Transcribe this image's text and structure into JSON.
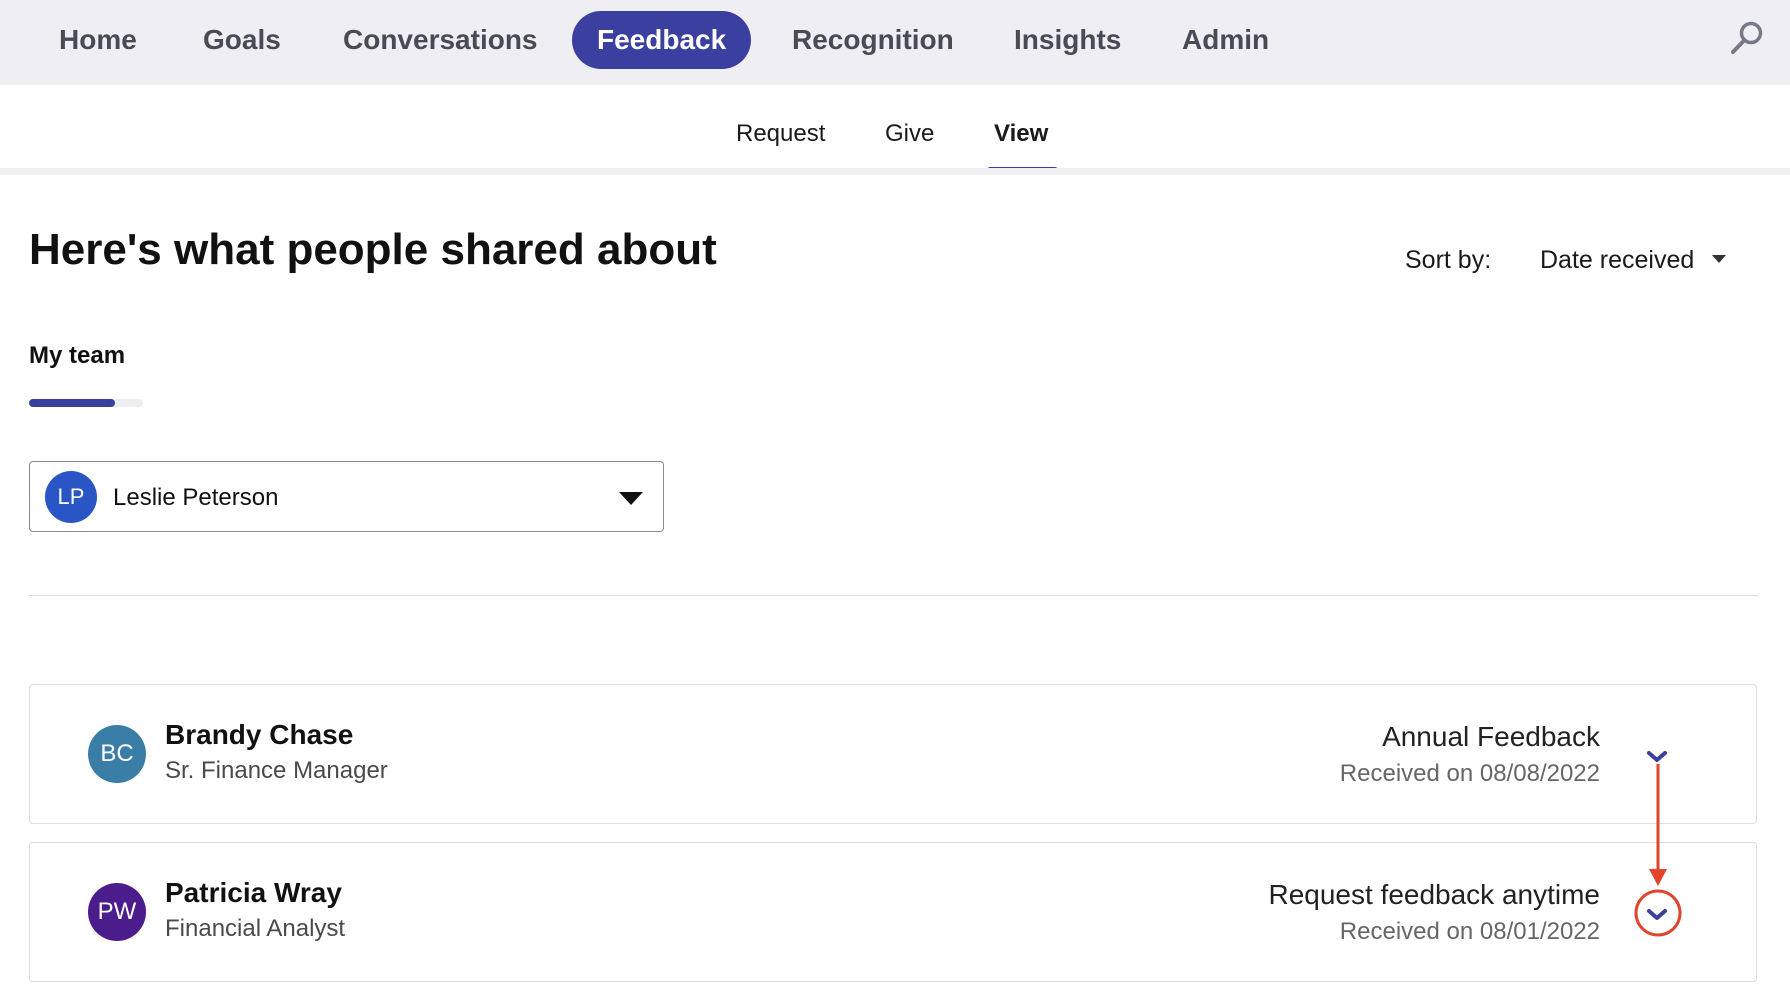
{
  "nav": {
    "items": [
      {
        "label": "Home"
      },
      {
        "label": "Goals"
      },
      {
        "label": "Conversations"
      },
      {
        "label": "Feedback",
        "active": true
      },
      {
        "label": "Recognition"
      },
      {
        "label": "Insights"
      },
      {
        "label": "Admin"
      }
    ],
    "search_icon": "search-icon"
  },
  "subnav": {
    "tabs": [
      {
        "label": "Request"
      },
      {
        "label": "Give"
      },
      {
        "label": "View",
        "active": true
      }
    ]
  },
  "page": {
    "title": "Here's what people shared about",
    "sort_label": "Sort by:",
    "sort_value": "Date received"
  },
  "team_tab": {
    "label": "My team",
    "progress_fraction": 0.75
  },
  "person_select": {
    "initials": "LP",
    "name": "Leslie Peterson",
    "avatar_color": "#2a55c4"
  },
  "feedback": [
    {
      "initials": "BC",
      "name": "Brandy Chase",
      "role": "Sr. Finance Manager",
      "type": "Annual Feedback",
      "received": "Received on 08/08/2022",
      "avatar_color": "#3a7ea8"
    },
    {
      "initials": "PW",
      "name": "Patricia Wray",
      "role": "Financial Analyst",
      "type": "Request feedback anytime",
      "received": "Received on 08/01/2022",
      "avatar_color": "#4b1d8c"
    }
  ],
  "colors": {
    "accent": "#3b3f9f",
    "annotation": "#e0452b",
    "nav_bg": "#eeeef3"
  }
}
